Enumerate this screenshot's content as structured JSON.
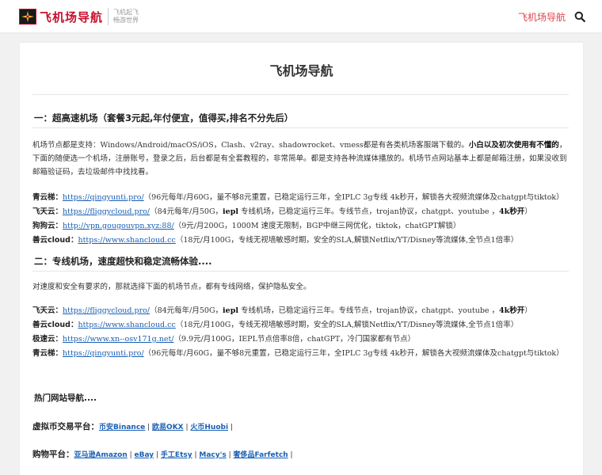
{
  "header": {
    "logo_title": "飞机场导航",
    "logo_tag_line1": "飞机起飞",
    "logo_tag_line2": "畅游世界",
    "nav_link": "飞机场导航",
    "colors": {
      "accent": "#e0444a",
      "logo": "#c8102e"
    }
  },
  "main": {
    "title": "飞机场导航",
    "section1": {
      "heading": "一：超高速机场（套餐3元起,年付便宜，值得买,排名不分先后）",
      "para_a": "机场节点都是支持：Windows/Android/macOS/iOS，Clash、v2ray、shadowrocket、vmess都是有各类机场客服端下载的。",
      "para_bold": "小白以及初次使用有不懂的",
      "para_b": "，下面的随便选一个机场，注册账号，登录之后，后台都是有全套教程的，非常简单。都是支持各种流媒体播放的。机场节点网站基本上都是邮箱注册，如果没收到邮箱验证码，去垃圾邮件中找找看。",
      "items": [
        {
          "name": "青云梯：",
          "url": "https://qingyunti.pro/",
          "desc": "（96元每年/月60G，量不够8元重置，已稳定运行三年，全IPLC 3g专线 4k秒开，解锁各大视频流媒体及chatgpt与tiktok）"
        },
        {
          "name": "飞天云：",
          "url": "https://fliggycloud.pro/",
          "desc_a": "（84元每年/月50G，",
          "desc_bold1": "iepl",
          "desc_b": " 专线机场，已稳定运行三年。专线节点，trojan协议，chatgpt、youtube ，",
          "desc_bold2": "4k秒开",
          "desc_c": "）"
        },
        {
          "name": "狗狗云：",
          "url": "http://vpn.gougouvpn.xyz:88/",
          "desc": "（9元/月200G，1000M 速度无限制，BGP中继三网优化，tiktok，chatGPT解锁）"
        },
        {
          "name": "善云cloud：",
          "url": "https://www.shancloud.cc",
          "desc": "（18元/月100G，专线无视墙敏感时期，安全的SLA,解锁Netflix/YT/Disney等流媒体,全节点1倍率）"
        }
      ]
    },
    "section2": {
      "heading": "二：专线机场，速度超快和稳定流畅体验....",
      "para": "对速度和安全有要求的，那就选择下面的机场节点，都有专线网络，保护隐私安全。",
      "items": [
        {
          "name": "飞天云：",
          "url": "https://fliggycloud.pro/",
          "desc_a": "（84元每年/月50G，",
          "desc_bold1": "iepl",
          "desc_b": " 专线机场，已稳定运行三年。专线节点，trojan协议，chatgpt、youtube ，",
          "desc_bold2": "4k秒开",
          "desc_c": "）"
        },
        {
          "name": "善云cloud：",
          "url": "https://www.shancloud.cc",
          "desc": "（18元/月100G，专线无视墙敏感时期，安全的SLA,解锁Netflix/YT/Disney等流媒体,全节点1倍率）"
        },
        {
          "name": "极速云：",
          "url": "https://www.xn--osv171g.net/",
          "desc": "（9.9元/月100G，IEPL节点倍率8倍，chatGPT，冷门国家都有节点）"
        },
        {
          "name": "青云梯：",
          "url": "https://qingyunti.pro/",
          "desc": "（96元每年/月60G，量不够8元重置，已稳定运行三年，全IPLC 3g专线 4k秒开，解锁各大视频流媒体及chatgpt与tiktok）"
        }
      ]
    },
    "section3": {
      "heading": "热门网站导航....",
      "crypto_label": "虚拟币交易平台：",
      "crypto_links": [
        "币安Binance",
        "欧易OKX",
        "火币Huobi"
      ],
      "shop_label": "购物平台：",
      "shop_links": [
        "亚马逊Amazon",
        "eBay",
        "手工Etsy",
        "Macy's",
        "奢侈品Farfetch"
      ]
    }
  }
}
